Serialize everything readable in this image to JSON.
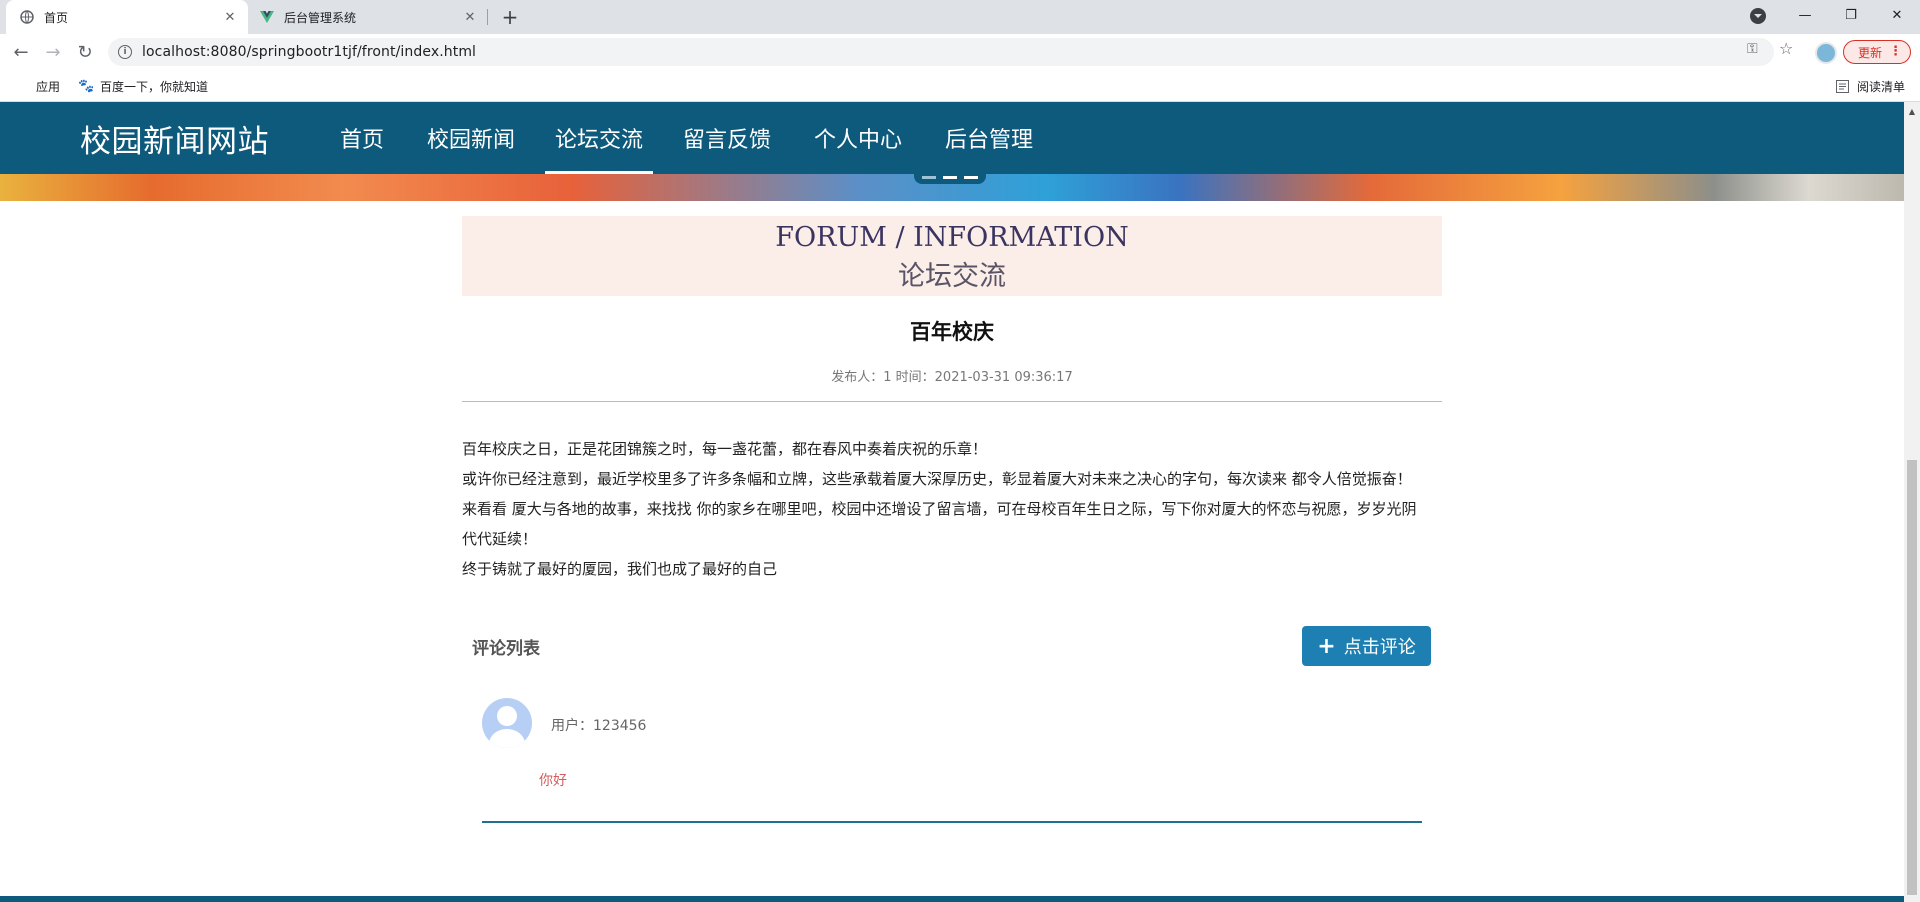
{
  "browser": {
    "tabs": [
      {
        "title": "首页",
        "active": true
      },
      {
        "title": "后台管理系统",
        "active": false
      }
    ],
    "url": "localhost:8080/springbootr1tjf/front/index.html",
    "update_label": "更新",
    "bookmarks": {
      "apps_label": "应用",
      "baidu_label": "百度一下，你就知道",
      "reading_list_label": "阅读清单"
    }
  },
  "site": {
    "title": "校园新闻网站",
    "menu": [
      "首页",
      "校园新闻",
      "论坛交流",
      "留言反馈",
      "个人中心",
      "后台管理"
    ],
    "active_menu": "论坛交流"
  },
  "section": {
    "title_en": "FORUM / INFORMATION",
    "title_cn": "论坛交流"
  },
  "post": {
    "title": "百年校庆",
    "meta": "发布人：1 时间：2021-03-31 09:36:17",
    "paragraphs": [
      "百年校庆之日，正是花团锦簇之时，每一盏花蕾，都在春风中奏着庆祝的乐章！",
      "或许你已经注意到，最近学校里多了许多条幅和立牌，这些承载着厦大深厚历史，彰显着厦大对未来之决心的字句，每次读来 都令人倍觉振奋！",
      "来看看 厦大与各地的故事，来找找 你的家乡在哪里吧，校园中还增设了留言墙，可在母校百年生日之际，写下你对厦大的怀恋与祝愿，岁岁光阴 代代延续！",
      "终于铸就了最好的厦园，我们也成了最好的自己"
    ]
  },
  "comments": {
    "title": "评论列表",
    "add_button": "点击评论",
    "items": [
      {
        "user": "用户：123456",
        "text": "你好"
      }
    ]
  },
  "colors": {
    "header_bg": "#0e5a7c",
    "button_bg": "#1d7fb2",
    "heading_box_bg": "#fbede7",
    "comment_text": "#d65c5c"
  }
}
